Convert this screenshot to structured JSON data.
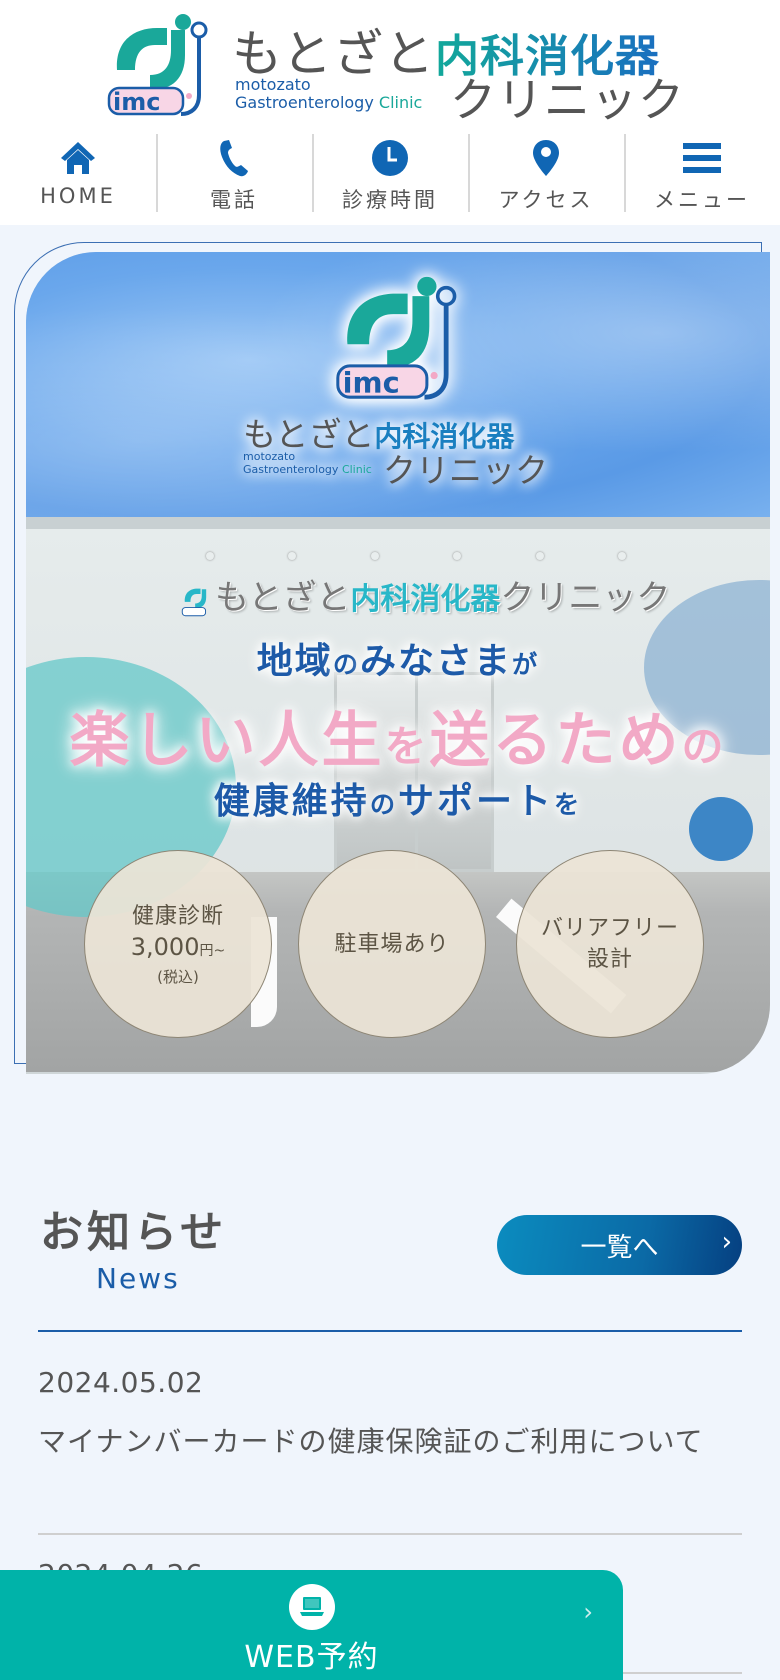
{
  "header": {
    "logo": {
      "name_hiragana": "もとざと",
      "name_accent": "内科消化器",
      "name_clinic": "クリニック",
      "name_en_line1": "motozato",
      "name_en_line2": "Gastroenterology",
      "name_en_clinic": "Clinic"
    },
    "nav": [
      {
        "label": "HOME",
        "icon": "home-icon"
      },
      {
        "label": "電話",
        "icon": "phone-icon"
      },
      {
        "label": "診療時間",
        "icon": "clock-icon"
      },
      {
        "label": "アクセス",
        "icon": "map-pin-icon"
      },
      {
        "label": "メニュー",
        "icon": "hamburger-menu-icon"
      }
    ]
  },
  "hero": {
    "sign": {
      "hiragana": "もとざと",
      "accent": "内科消化器",
      "clinic": "クリニック"
    },
    "copy": {
      "line1_a": "地域",
      "line1_b": "の",
      "line1_c": "みなさま",
      "line1_d": "が",
      "line2_a": "楽しい人生",
      "line2_b": "を",
      "line2_c": "送るため",
      "line2_d": "の",
      "line3_a": "健康維持",
      "line3_b": "の",
      "line3_c": "サポート",
      "line3_d": "を"
    },
    "features": [
      {
        "title": "健康診断",
        "price": "3,000",
        "price_unit": "円~",
        "note": "(税込)"
      },
      {
        "title": "駐車場あり"
      },
      {
        "title_line1": "バリアフリー",
        "title_line2": "設計"
      }
    ]
  },
  "news": {
    "title": "お知らせ",
    "subtitle": "News",
    "list_button": "一覧へ",
    "items": [
      {
        "date": "2024.05.02",
        "title": "マイナンバーカードの健康保険証のご利用について"
      },
      {
        "date": "2024.04.26",
        "title": ""
      }
    ]
  },
  "web_reserve": {
    "label": "WEB予約"
  },
  "colors": {
    "primary_blue": "#1b5da8",
    "teal": "#00b3a9",
    "pink": "#f2a9c6",
    "background": "#f0f5fc"
  }
}
